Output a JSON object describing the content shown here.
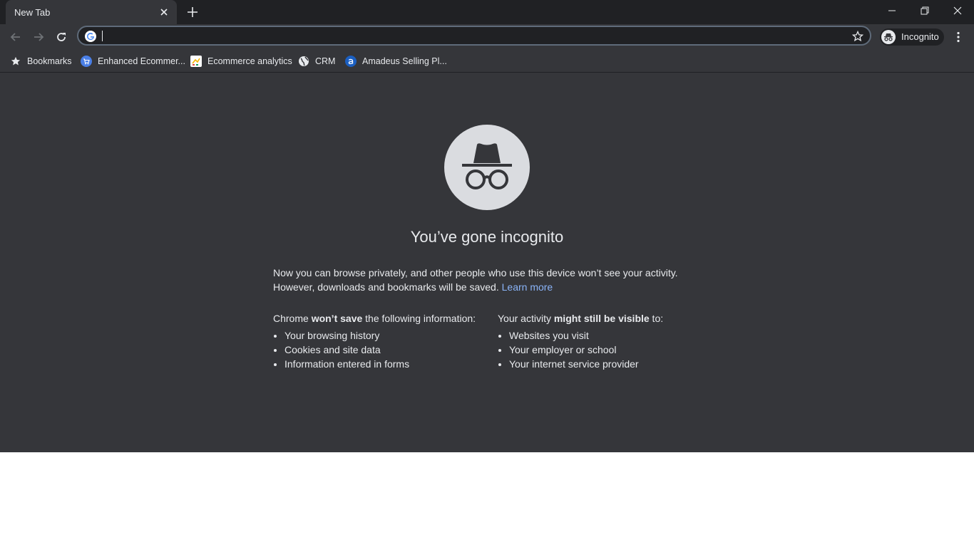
{
  "tab": {
    "title": "New Tab"
  },
  "window": {
    "minimize_icon": "minimize-icon",
    "restore_icon": "restore-icon",
    "close_icon": "close-icon"
  },
  "toolbar": {
    "omnibox_value": "",
    "profile_label": "Incognito"
  },
  "bookmarks": [
    {
      "label": "Bookmarks",
      "icon": "star-icon"
    },
    {
      "label": "Enhanced Ecommer...",
      "icon": "cart-icon"
    },
    {
      "label": "Ecommerce analytics",
      "icon": "analytics-icon"
    },
    {
      "label": "CRM",
      "icon": "globe-icon"
    },
    {
      "label": "Amadeus Selling Pl...",
      "icon": "amadeus-icon"
    }
  ],
  "page": {
    "headline": "You’ve gone incognito",
    "desc_line1": "Now you can browse privately, and other people who use this device won’t see your activity.",
    "desc_line2": "However, downloads and bookmarks will be saved.",
    "learn_more": "Learn more",
    "left_col": {
      "title_pre": "Chrome ",
      "title_strong": "won’t save",
      "title_post": " the following information:",
      "items": [
        "Your browsing history",
        "Cookies and site data",
        "Information entered in forms"
      ]
    },
    "right_col": {
      "title_pre": "Your activity ",
      "title_strong": "might still be visible",
      "title_post": " to:",
      "items": [
        "Websites you visit",
        "Your employer or school",
        "Your internet service provider"
      ]
    }
  },
  "colors": {
    "frame": "#202124",
    "toolbar": "#35363a",
    "text": "#e8eaed",
    "link": "#8ab4f8"
  }
}
